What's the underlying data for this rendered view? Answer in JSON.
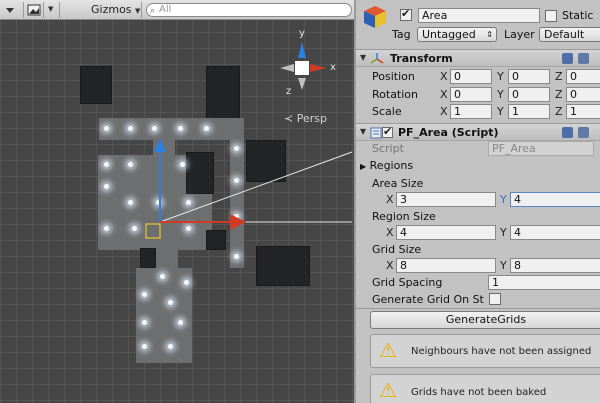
{
  "scene": {
    "gizmos_label": "Gizmos",
    "search_placeholder": "All",
    "persp_label": "Persp",
    "axis_y": "y",
    "axis_x": "x",
    "axis_z": "z"
  },
  "object": {
    "name": "Area",
    "active": true,
    "static_label": "Static",
    "static_checked": false,
    "tag_label": "Tag",
    "tag_value": "Untagged",
    "layer_label": "Layer",
    "layer_value": "Default"
  },
  "transform": {
    "title": "Transform",
    "position_label": "Position",
    "rotation_label": "Rotation",
    "scale_label": "Scale",
    "position": {
      "x": "0",
      "y": "0",
      "z": "0"
    },
    "rotation": {
      "x": "0",
      "y": "0",
      "z": "0"
    },
    "scale": {
      "x": "1",
      "y": "1",
      "z": "1"
    }
  },
  "script": {
    "title": "PF_Area (Script)",
    "script_label": "Script",
    "script_value": "PF_Area",
    "regions_label": "Regions",
    "area_size_label": "Area Size",
    "area_size": {
      "x": "3",
      "y": "4"
    },
    "region_size_label": "Region Size",
    "region_size": {
      "x": "4",
      "y": "4"
    },
    "grid_size_label": "Grid Size",
    "grid_size": {
      "x": "8",
      "y": "8"
    },
    "grid_spacing_label": "Grid Spacing",
    "grid_spacing": "1",
    "generate_on_start_label": "Generate Grid On St",
    "generate_button": "GenerateGrids",
    "warnings": [
      "Neighbours have not been assigned",
      "Grids have not been baked"
    ]
  },
  "axis_letters": {
    "x": "X",
    "y": "Y",
    "z": "Z"
  },
  "colors": {
    "inspector_bg": "#c2c2c2",
    "scene_bg": "#464646",
    "x_axis": "#d23a24",
    "y_axis": "#2b7fe0",
    "warning": "#e9b000"
  }
}
